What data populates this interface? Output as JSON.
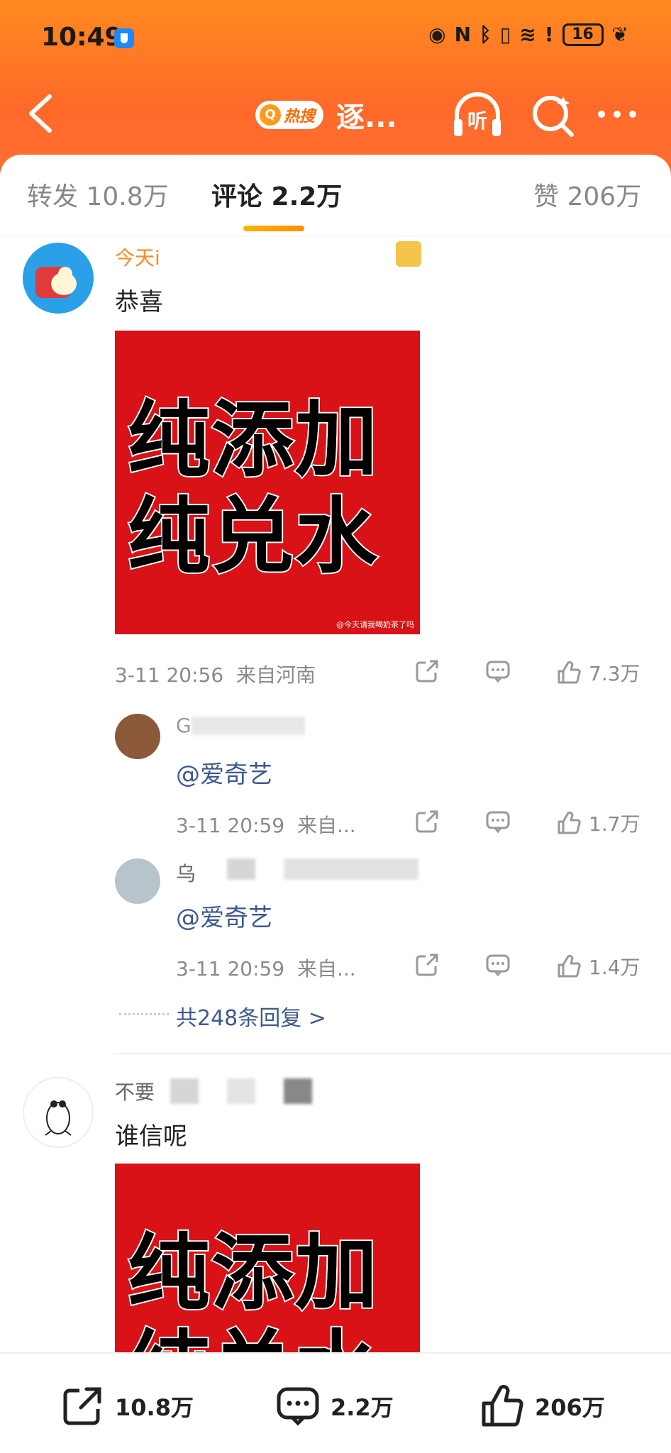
{
  "status": {
    "time": "10:49",
    "battery": "16"
  },
  "nav": {
    "hot_badge": "热搜",
    "title": "逐...",
    "listen_label": "听"
  },
  "tabs": [
    {
      "label": "转发 10.8万"
    },
    {
      "label": "评论 2.2万"
    },
    {
      "label": "赞 206万"
    }
  ],
  "comments": [
    {
      "name": "今天i",
      "text": "恭喜",
      "image_lines": [
        "纯添加",
        "纯兑水"
      ],
      "image_watermark": "@今天请我喝奶茶了吗",
      "time": "3-11 20:56",
      "location": "来自河南",
      "likes": "7.3万",
      "replies": [
        {
          "name": "G",
          "text": "@爱奇艺",
          "time": "3-11 20:59",
          "location": "来自...",
          "likes": "1.7万"
        },
        {
          "name": "乌",
          "text": "@爱奇艺",
          "time": "3-11 20:59",
          "location": "来自...",
          "likes": "1.4万"
        }
      ],
      "more_replies": "共248条回复 >"
    },
    {
      "name": "不要",
      "text": "谁信呢",
      "image_lines": [
        "纯添加",
        "纯兑水"
      ]
    }
  ],
  "bottom": {
    "repost": "10.8万",
    "comment": "2.2万",
    "like": "206万"
  },
  "colors": {
    "header_top": "#ff8a1f",
    "header_bottom": "#ff6e31",
    "link": "#3d5a8c",
    "accent": "#ff8c00",
    "image_red": "#d81216"
  }
}
